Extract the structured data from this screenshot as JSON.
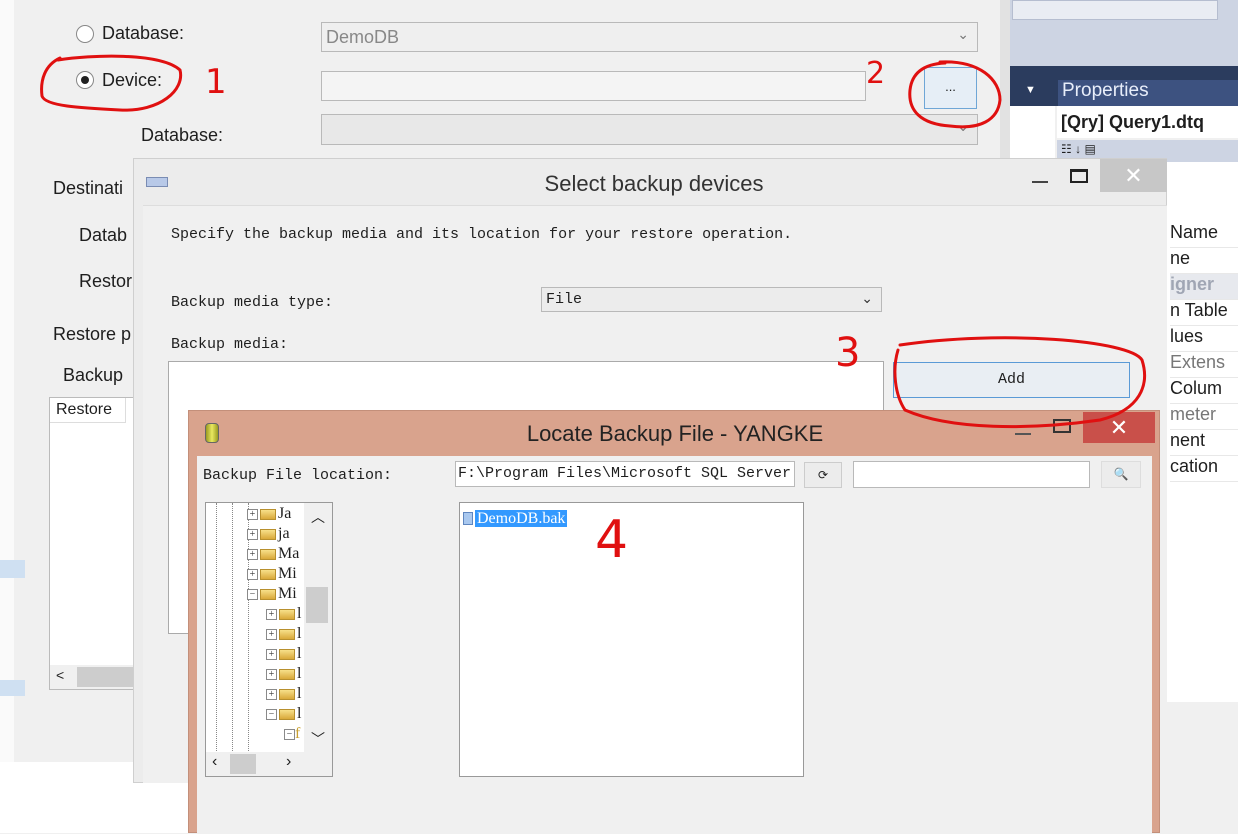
{
  "restore_dialog": {
    "source_database_label": "Database:",
    "source_database_value": "DemoDB",
    "device_label": "Device:",
    "device_selected": true,
    "device_value": "",
    "browse_label": "...",
    "device_database_label": "Database:",
    "destination_label": "Destinati",
    "dest_database_label": "Datab",
    "restore_to_label": "Restor",
    "restore_plan_label": "Restore p",
    "backup_sets_label": "Backup",
    "grid_header": "Restore"
  },
  "properties_panel": {
    "title": "Properties",
    "object": "[Qry] Query1.dtq",
    "rows": [
      "Name",
      "ne",
      "igner",
      "n Table",
      "lues",
      "Extens",
      "Colum",
      "meter",
      "nent",
      "cation"
    ]
  },
  "select_devices": {
    "title": "Select backup devices",
    "instruction": "Specify the backup media and its location for your restore operation.",
    "media_type_label": "Backup media type:",
    "media_type_value": "File",
    "media_label": "Backup media:",
    "add_label": "Add"
  },
  "locate_file": {
    "title": "Locate Backup File - YANGKE",
    "location_label": "Backup File location:",
    "location_value": "F:\\Program Files\\Microsoft SQL Server",
    "search_value": "",
    "tree": [
      "Ja",
      "ja",
      "Ma",
      "Mi",
      "Mi",
      "l",
      "l",
      "l",
      "l",
      "l",
      "l",
      "f"
    ],
    "files": [
      {
        "name": "DemoDB.bak",
        "selected": true
      }
    ]
  },
  "annotations": [
    "1",
    "2",
    "3",
    "4"
  ],
  "colors": {
    "annotation": "#e01010",
    "selection": "#3399ff",
    "locate_border": "#d9a38d",
    "close_red": "#c9504a"
  }
}
